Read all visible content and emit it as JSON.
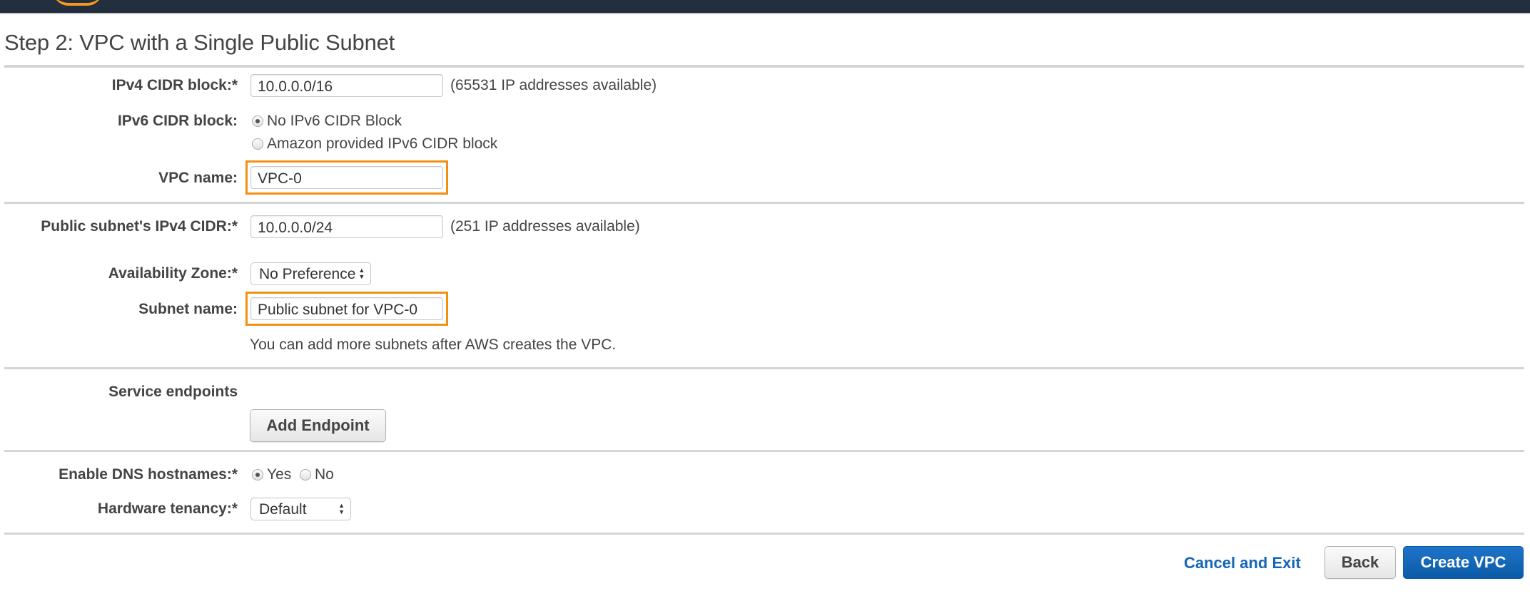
{
  "header": {
    "logo": "aws-logo"
  },
  "page": {
    "title": "Step 2: VPC with a Single Public Subnet"
  },
  "vpc": {
    "ipv4_cidr": {
      "label": "IPv4 CIDR block:*",
      "value": "10.0.0.0/16",
      "hint": "(65531 IP addresses available)"
    },
    "ipv6_cidr": {
      "label": "IPv6 CIDR block:",
      "options": [
        {
          "label": "No IPv6 CIDR Block",
          "checked": true
        },
        {
          "label": "Amazon provided IPv6 CIDR block",
          "checked": false
        }
      ]
    },
    "name": {
      "label": "VPC name:",
      "value": "VPC-0"
    }
  },
  "subnet": {
    "ipv4_cidr": {
      "label": "Public subnet's IPv4 CIDR:*",
      "value": "10.0.0.0/24",
      "hint": "(251 IP addresses available)"
    },
    "availability_zone": {
      "label": "Availability Zone:*",
      "value": "No Preference"
    },
    "name": {
      "label": "Subnet name:",
      "value": "Public subnet for VPC-0"
    },
    "note": "You can add more subnets after AWS creates the VPC."
  },
  "endpoints": {
    "label": "Service endpoints",
    "add_button": "Add Endpoint"
  },
  "dns": {
    "label": "Enable DNS hostnames:*",
    "options": [
      {
        "label": "Yes",
        "checked": true
      },
      {
        "label": "No",
        "checked": false
      }
    ]
  },
  "tenancy": {
    "label": "Hardware tenancy:*",
    "value": "Default"
  },
  "footer": {
    "cancel": "Cancel and Exit",
    "back": "Back",
    "create": "Create VPC"
  },
  "colors": {
    "header_bg": "#232f3e",
    "highlight": "#f29111",
    "primary": "#0b5ba6",
    "link": "#1566b7"
  }
}
